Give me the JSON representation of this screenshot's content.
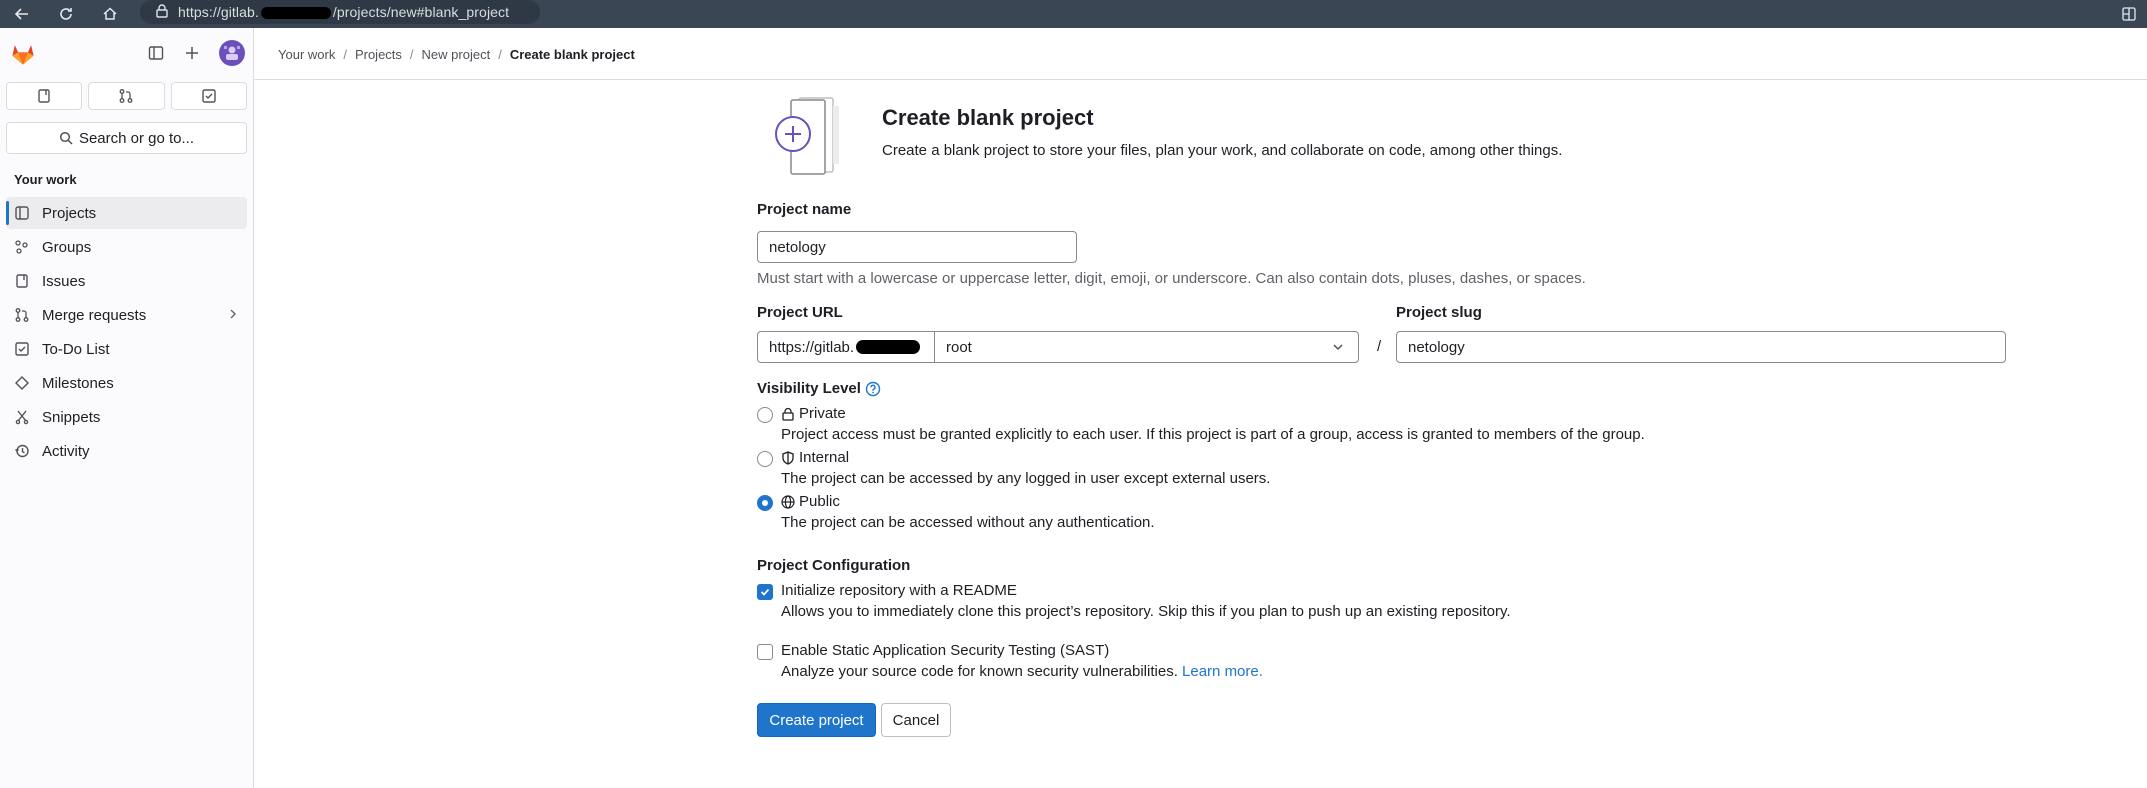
{
  "browser": {
    "url_prefix": "https://gitlab.",
    "url_suffix": "/projects/new#blank_project"
  },
  "sidebar": {
    "search_label": "Search or go to...",
    "section_title": "Your work",
    "items": [
      {
        "label": "Projects",
        "icon": "project-icon"
      },
      {
        "label": "Groups",
        "icon": "group-icon"
      },
      {
        "label": "Issues",
        "icon": "issues-icon"
      },
      {
        "label": "Merge requests",
        "icon": "merge-request-icon"
      },
      {
        "label": "To-Do List",
        "icon": "todo-icon"
      },
      {
        "label": "Milestones",
        "icon": "milestone-icon"
      },
      {
        "label": "Snippets",
        "icon": "snippet-icon"
      },
      {
        "label": "Activity",
        "icon": "history-icon"
      }
    ]
  },
  "breadcrumb": [
    "Your work",
    "Projects",
    "New project",
    "Create blank project"
  ],
  "header": {
    "title": "Create blank project",
    "description": "Create a blank project to store your files, plan your work, and collaborate on code, among other things."
  },
  "form": {
    "project_name_label": "Project name",
    "project_name_value": "netology",
    "project_name_help": "Must start with a lowercase or uppercase letter, digit, emoji, or underscore. Can also contain dots, pluses, dashes, or spaces.",
    "project_url_label": "Project URL",
    "project_url_prefix": "https://gitlab.",
    "namespace_value": "root",
    "slash": "/",
    "project_slug_label": "Project slug",
    "project_slug_value": "netology",
    "visibility_label": "Visibility Level",
    "visibility_options": [
      {
        "label": "Private",
        "desc": "Project access must be granted explicitly to each user. If this project is part of a group, access is granted to members of the group.",
        "checked": false
      },
      {
        "label": "Internal",
        "desc": "The project can be accessed by any logged in user except external users.",
        "checked": false
      },
      {
        "label": "Public",
        "desc": "The project can be accessed without any authentication.",
        "checked": true
      }
    ],
    "config_label": "Project Configuration",
    "readme_label": "Initialize repository with a README",
    "readme_desc": "Allows you to immediately clone this project’s repository. Skip this if you plan to push up an existing repository.",
    "readme_checked": true,
    "sast_label": "Enable Static Application Security Testing (SAST)",
    "sast_desc": "Analyze your source code for known security vulnerabilities.",
    "sast_link": "Learn more.",
    "sast_checked": false,
    "create_button": "Create project",
    "cancel_button": "Cancel"
  },
  "colors": {
    "accent": "#1f75cb",
    "browser_bar": "#3a4654",
    "sidebar_bg": "#fbfafd"
  }
}
